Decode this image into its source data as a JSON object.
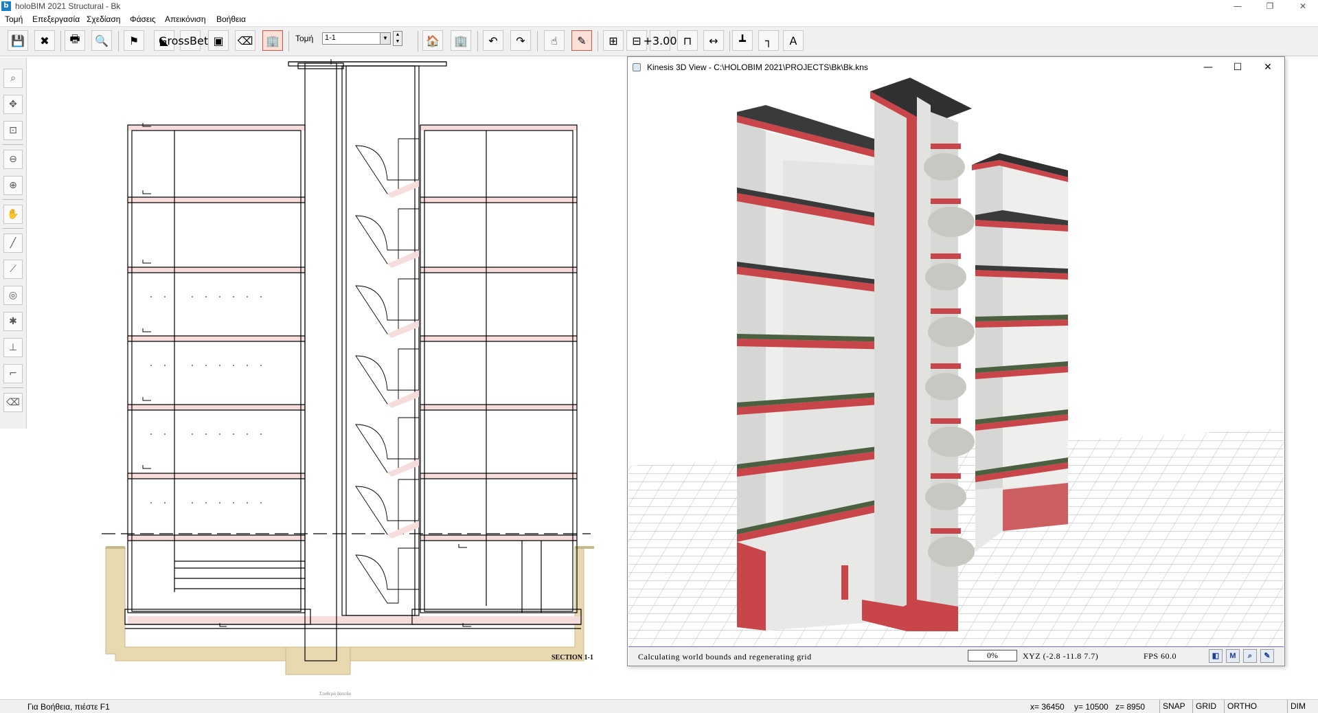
{
  "window": {
    "title": "holoBIM 2021 Structural - Bk",
    "app_icon": "b"
  },
  "menu": [
    "Τομή",
    "Επεξεργασία",
    "Σχεδίαση",
    "Φάσεις",
    "Απεικόνιση",
    "Βοήθεια"
  ],
  "toolbar": {
    "section_label": "Τομή",
    "section_value": "1-1",
    "gross_label": "Gross",
    "gross_label2": "Beton",
    "elevation_label": "+3.00",
    "text_tool": "A"
  },
  "drawing": {
    "section_title": "SECTION 1-1",
    "bottom_caption": "Σταθερά δάπεδα"
  },
  "kinesis": {
    "title": "Kinesis 3D View - C:\\HOLOBIM 2021\\PROJECTS\\Bk\\Bk.kns",
    "status_text": "Calculating world bounds and regenerating grid",
    "progress": "0%",
    "xyz": "XYZ (-2.8 -11.8 7.7)",
    "fps": "FPS  60.0",
    "btn_m": "M"
  },
  "statusbar": {
    "help": "Για Βοήθεια, πιέστε F1",
    "x": "x=  36450",
    "y": "y=  10500",
    "z": "z=   8950",
    "snap": "SNAP",
    "grid": "GRID",
    "ortho": "ORTHO",
    "dim": "DIM"
  },
  "colors": {
    "accent_red": "#c8454a",
    "toolbar_bg": "#f0f0f0",
    "ground": "#e8d9b0"
  }
}
